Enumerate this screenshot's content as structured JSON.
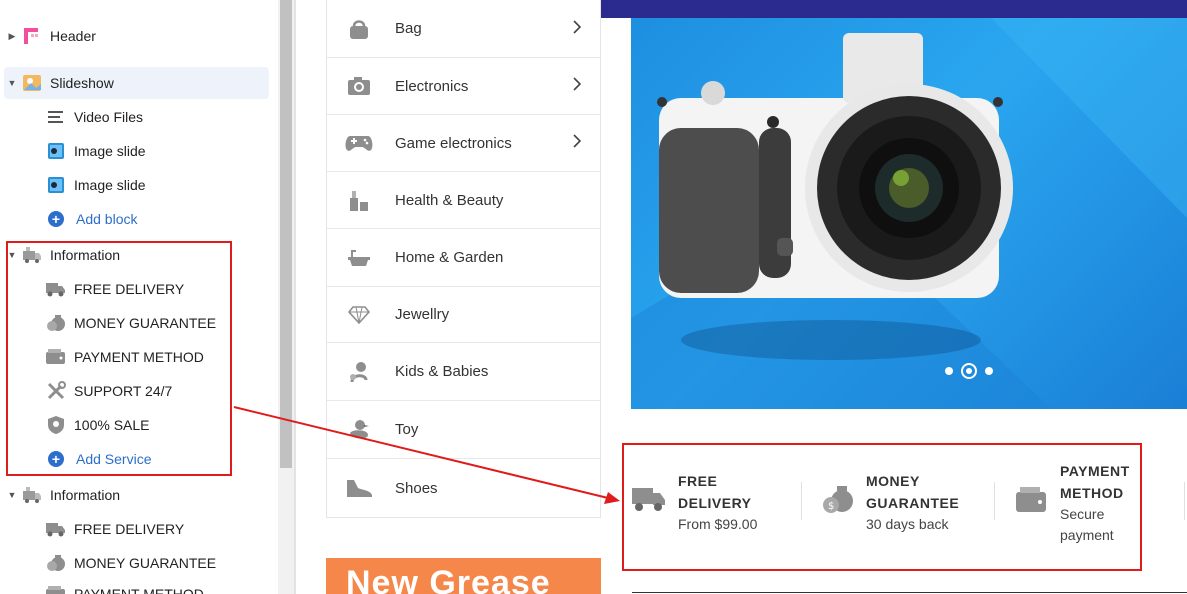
{
  "sidebar": {
    "sections": [
      {
        "label": "Header",
        "icon": "header-icon",
        "expanded": false
      },
      {
        "label": "Slideshow",
        "icon": "slideshow-icon",
        "expanded": true,
        "children": [
          {
            "label": "Video Files",
            "icon": "lines-icon"
          },
          {
            "label": "Image slide",
            "icon": "image-icon"
          },
          {
            "label": "Image slide",
            "icon": "image-icon"
          },
          {
            "label": "Add block",
            "icon": "plus-circle-icon"
          }
        ]
      },
      {
        "label": "Information",
        "icon": "information-icon",
        "expanded": true,
        "children": [
          {
            "label": "FREE DELIVERY",
            "icon": "truck-icon"
          },
          {
            "label": "MONEY GUARANTEE",
            "icon": "money-bag-icon"
          },
          {
            "label": "PAYMENT METHOD",
            "icon": "wallet-icon"
          },
          {
            "label": "SUPPORT 24/7",
            "icon": "tools-icon"
          },
          {
            "label": "100% SALE",
            "icon": "shield-icon"
          },
          {
            "label": "Add Service",
            "icon": "plus-circle-icon"
          }
        ]
      },
      {
        "label": "Information",
        "icon": "information-icon",
        "expanded": true,
        "children": [
          {
            "label": "FREE DELIVERY",
            "icon": "truck-icon"
          },
          {
            "label": "MONEY GUARANTEE",
            "icon": "money-bag-icon"
          },
          {
            "label": "PAYMENT METHOD",
            "icon": "wallet-icon"
          }
        ]
      }
    ]
  },
  "preview": {
    "categories": [
      {
        "label": "Bag",
        "icon": "bag-icon",
        "has_submenu": true
      },
      {
        "label": "Electronics",
        "icon": "camera-icon",
        "has_submenu": true
      },
      {
        "label": "Game electronics",
        "icon": "gamepad-icon",
        "has_submenu": true
      },
      {
        "label": "Health & Beauty",
        "icon": "cosmetics-icon",
        "has_submenu": false
      },
      {
        "label": "Home & Garden",
        "icon": "bathtub-icon",
        "has_submenu": false
      },
      {
        "label": "Jewellry",
        "icon": "diamond-icon",
        "has_submenu": false
      },
      {
        "label": "Kids & Babies",
        "icon": "baby-icon",
        "has_submenu": false
      },
      {
        "label": "Toy",
        "icon": "duck-icon",
        "has_submenu": false
      },
      {
        "label": "Shoes",
        "icon": "shoe-icon",
        "has_submenu": false
      }
    ],
    "slideshow": {
      "slide_count": 3,
      "active_slide": 2
    },
    "promo_text": "New Grease",
    "services": [
      {
        "title_1": "FREE",
        "title_2": "DELIVERY",
        "sub_1": "From $99.00",
        "sub_2": "",
        "icon": "truck-icon"
      },
      {
        "title_1": "MONEY",
        "title_2": "GUARANTEE",
        "sub_1": "30 days back",
        "sub_2": "",
        "icon": "money-bag-icon"
      },
      {
        "title_1": "PAYMENT",
        "title_2": "METHOD",
        "sub_1": "Secure",
        "sub_2": "payment",
        "icon": "wallet-icon"
      }
    ]
  },
  "colors": {
    "accent_blue": "#2c6ecb",
    "annotation_red": "#e01b1b",
    "nav_dark": "#2a2a8f",
    "nav_pink": "#ff3f8e",
    "banner_blue": "#2aa6ef",
    "promo_orange": "#f5874a"
  }
}
